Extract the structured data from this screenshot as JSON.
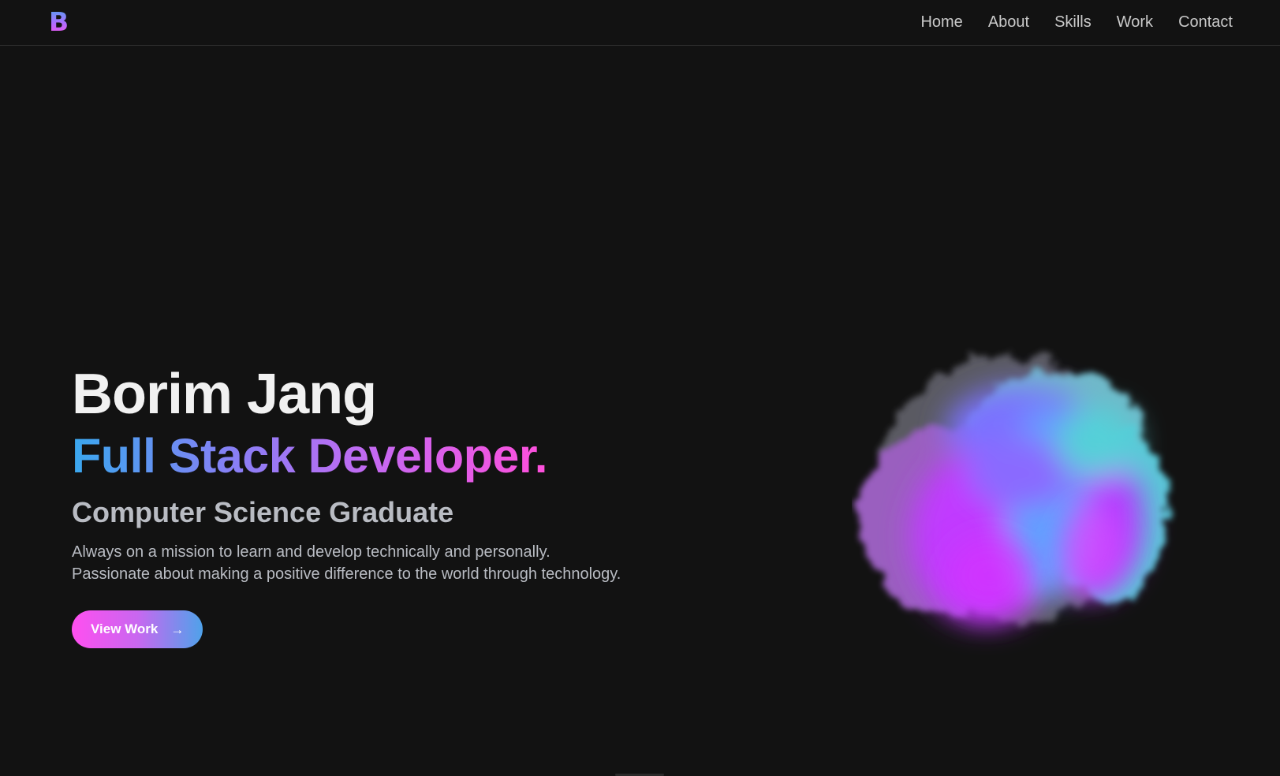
{
  "brand": {
    "logo_letter": "B"
  },
  "nav": {
    "items": [
      {
        "label": "Home"
      },
      {
        "label": "About"
      },
      {
        "label": "Skills"
      },
      {
        "label": "Work"
      },
      {
        "label": "Contact"
      }
    ]
  },
  "hero": {
    "name": "Borim Jang",
    "role": "Full Stack Developer.",
    "degree": "Computer Science Graduate",
    "tagline_lines": [
      "Always on a mission to learn and develop technically and personally.",
      "Passionate about making a positive difference to the world through technology."
    ],
    "cta_label": "View Work",
    "cta_icon": "arrow-right-icon"
  },
  "colors": {
    "background": "#121212",
    "gradient_blue": "#3aa7ee",
    "gradient_purple": "#c26af2",
    "gradient_pink": "#ff4fdc"
  },
  "illustration": {
    "icon": "nebula-blob-illustration"
  }
}
